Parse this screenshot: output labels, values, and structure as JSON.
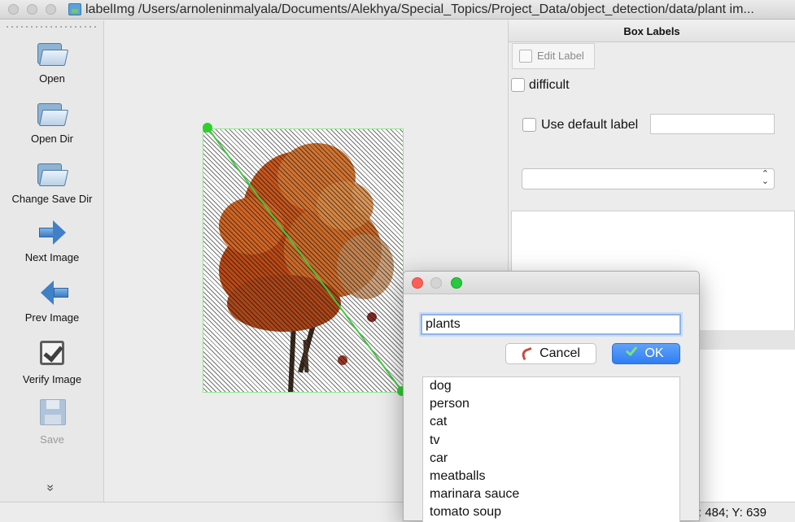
{
  "window": {
    "title": "labelImg /Users/arnoleninmalyala/Documents/Alekhya/Special_Topics/Project_Data/object_detection/data/plant im..."
  },
  "toolbar": {
    "open": "Open",
    "open_dir": "Open Dir",
    "change_save_dir": "Change Save Dir",
    "next_image": "Next Image",
    "prev_image": "Prev Image",
    "verify_image": "Verify Image",
    "save": "Save",
    "more": "»"
  },
  "dock": {
    "title": "Box Labels",
    "edit_label": "Edit Label",
    "difficult": "difficult",
    "use_default_label": "Use default label",
    "default_label_value": "",
    "combo_value": ""
  },
  "status": {
    "coords": "X: 484; Y: 639"
  },
  "dialog": {
    "input_value": "plants",
    "cancel_label": "Cancel",
    "ok_label": "OK",
    "labels": [
      "dog",
      "person",
      "cat",
      "tv",
      "car",
      "meatballs",
      "marinara sauce",
      "tomato soup"
    ]
  },
  "colors": {
    "bbox_handle": "#2dd02d",
    "ok_button": "#2f7ef2"
  }
}
